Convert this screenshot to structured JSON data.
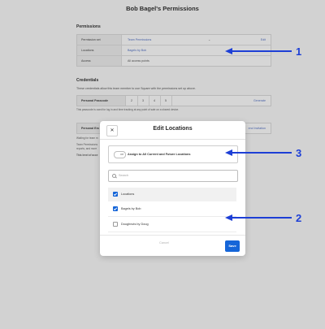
{
  "page": {
    "title": "Bob Bagel's Permissions"
  },
  "permissions": {
    "heading": "Permissions",
    "rows": [
      {
        "label": "Permission set",
        "value": "Team Permissions",
        "action": "Edit"
      },
      {
        "label": "Locations",
        "value": "Bagels by Bob"
      },
      {
        "label": "Access",
        "value": "All access points"
      }
    ]
  },
  "credentials": {
    "heading": "Credentials",
    "description": "These credentials allow this team member to use Square with the permissions set up above.",
    "passcode": {
      "label": "Personal Passcode",
      "digits": [
        "2",
        "3",
        "4",
        "5"
      ],
      "action": "Generate"
    },
    "note": "This passcode is used for log in and time tracking at any point of sale on a shared device."
  },
  "background": {
    "row_label": "Personal Em",
    "row_action": "end Invitation",
    "lines": [
      "Waiting for team m",
      "Team Permissions",
      "reports, and more",
      "This level of acce"
    ]
  },
  "modal": {
    "title": "Edit Locations",
    "close_icon": "close-icon",
    "assign": {
      "toggle_label": "Off",
      "text": "Assign to All Current and Future Locations"
    },
    "search_placeholder": "Search",
    "locations_header": "Locations",
    "locations": [
      {
        "name": "Bagels by Bob",
        "checked": true
      },
      {
        "name": "Doughnuts by Doug",
        "checked": false
      }
    ],
    "cancel_label": "Cancel",
    "save_label": "Save"
  },
  "annotations": [
    "1",
    "2",
    "3"
  ],
  "colors": {
    "accent": "#1565d8",
    "annotation": "#1d3fd6",
    "link": "#4a63a8"
  }
}
